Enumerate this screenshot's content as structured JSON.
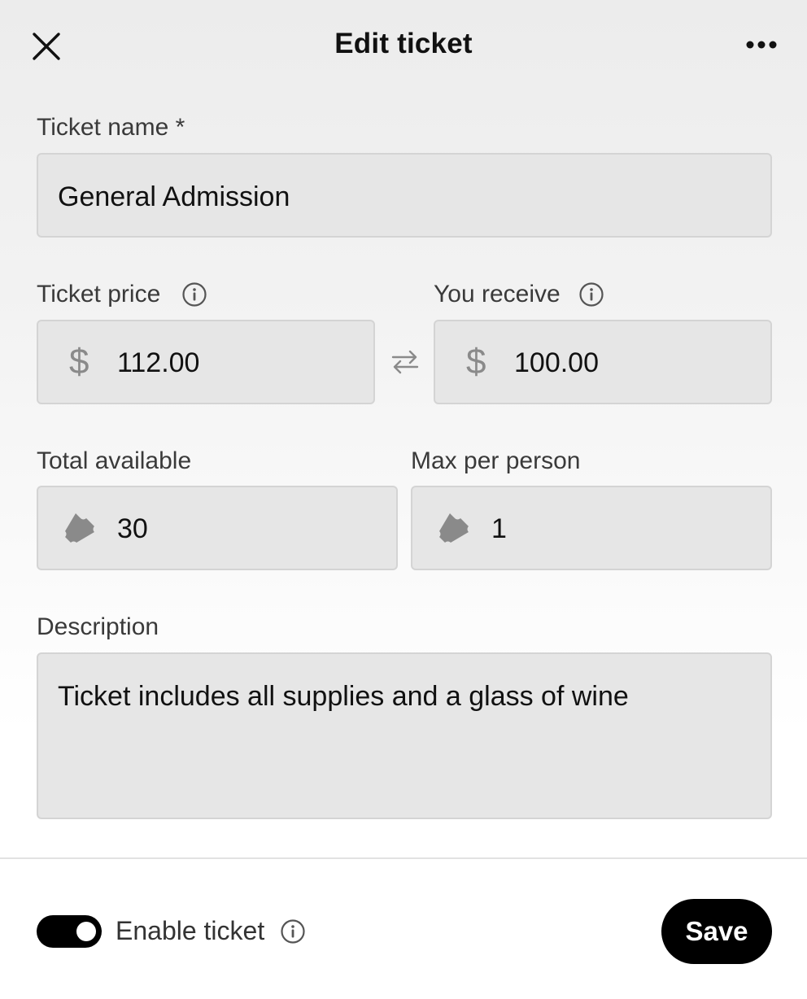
{
  "header": {
    "title": "Edit ticket",
    "close_icon": "close-icon",
    "more_icon": "more-horizontal-icon"
  },
  "form": {
    "ticket_name": {
      "label": "Ticket name *",
      "value": "General Admission"
    },
    "ticket_price": {
      "label": "Ticket price",
      "currency_symbol": "$",
      "value": "112.00"
    },
    "you_receive": {
      "label": "You receive",
      "currency_symbol": "$",
      "value": "100.00"
    },
    "total_available": {
      "label": "Total available",
      "value": "30"
    },
    "max_per_person": {
      "label": "Max per person",
      "value": "1"
    },
    "description": {
      "label": "Description",
      "value": "Ticket includes all supplies and a glass of wine"
    }
  },
  "footer": {
    "enable_label": "Enable ticket",
    "enabled": true,
    "save_label": "Save"
  },
  "colors": {
    "primary": "#000000",
    "field_bg": "#e6e6e6",
    "icon_gray": "#8a8a8a"
  }
}
